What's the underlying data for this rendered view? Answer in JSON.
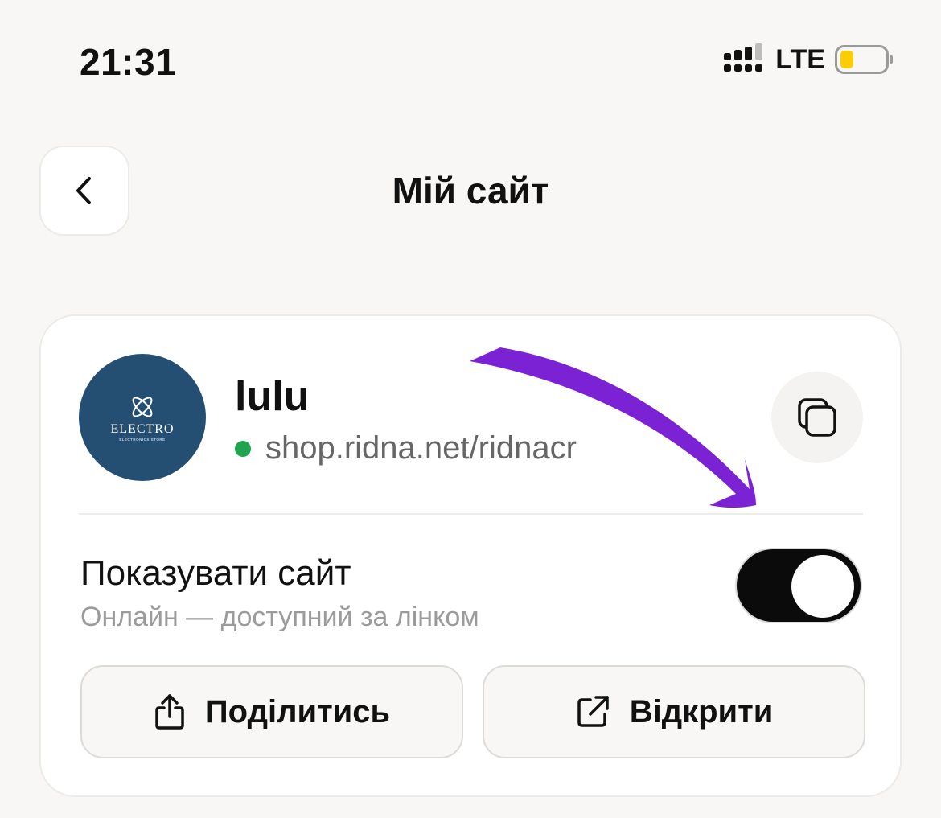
{
  "status_bar": {
    "time": "21:31",
    "network": "LTE",
    "battery_level": 0.3,
    "battery_color": "#ffcc00"
  },
  "header": {
    "title": "Мій сайт",
    "back_icon": "chevron-left-icon"
  },
  "site": {
    "name": "lulu",
    "url": "shop.ridna.net/ridnacr",
    "status_color": "#22a350",
    "avatar": {
      "brand": "ELECTRO",
      "subtitle": "ELECTRONICS STORE",
      "background": "#244f72"
    },
    "copy_icon": "copy-icon"
  },
  "visibility": {
    "title": "Показувати сайт",
    "subtitle": "Онлайн — доступний за лінком",
    "enabled": true
  },
  "actions": {
    "share_label": "Поділитись",
    "open_label": "Відкрити"
  },
  "annotation": {
    "arrow_color": "#7b22d4"
  }
}
